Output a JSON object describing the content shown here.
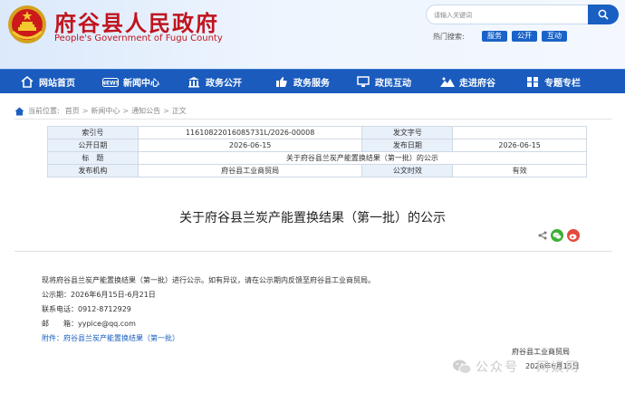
{
  "header": {
    "title_cn": "府谷县人民政府",
    "title_en": "People's Government of Fugu County",
    "search_placeholder": "请输入关键词",
    "hot_label": "热门搜索:",
    "hot_tags": [
      "服务",
      "公开",
      "互动"
    ]
  },
  "nav": {
    "items": [
      {
        "label": "网站首页",
        "icon": "home-icon"
      },
      {
        "label": "新闻中心",
        "icon": "news-icon"
      },
      {
        "label": "政务公开",
        "icon": "building-icon"
      },
      {
        "label": "政务服务",
        "icon": "thumbs-up-icon"
      },
      {
        "label": "政民互动",
        "icon": "monitor-icon"
      },
      {
        "label": "走进府谷",
        "icon": "landscape-icon"
      },
      {
        "label": "专题专栏",
        "icon": "column-icon"
      }
    ]
  },
  "breadcrumb": {
    "label": "当前位置:",
    "items": [
      "首页",
      "新闻中心",
      "通知公告",
      "正文"
    ]
  },
  "meta": {
    "index_label": "索引号",
    "index_value": "11610822016085731L/2026-00008",
    "doc_no_label": "发文字号",
    "doc_no_value": "",
    "open_date_label": "公开日期",
    "open_date_value": "2026-06-15",
    "pub_date_label": "发布日期",
    "pub_date_value": "2026-06-15",
    "title_label": "标　题",
    "title_value": "关于府谷县兰炭产能置换结果（第一批）的公示",
    "issuer_label": "发布机构",
    "issuer_value": "府谷县工业商贸局",
    "validity_label": "公文时效",
    "validity_value": "有效"
  },
  "document": {
    "title": "关于府谷县兰炭产能置换结果（第一批）的公示",
    "lines": [
      "现将府谷县兰炭产能置换结果（第一批）进行公示。如有异议，请在公示期内反馈至府谷县工业商贸局。",
      "公示期：2026年6月15日-6月21日",
      "联系电话：0912-8712929",
      "邮　　箱：yypice@qq.com"
    ],
    "attachment_label": "附件：",
    "attachment": "府谷县兰炭产能置换结果（第一批）",
    "sign_org": "府谷县工业商贸局",
    "sign_date": "2026年6月15日"
  },
  "watermark": {
    "text": "公众号 · 网娱网"
  },
  "colors": {
    "brand_red": "#c0141e",
    "nav_blue": "#1a5bbd",
    "link_blue": "#1a5fc2",
    "table_label_bg": "#e8f0fa"
  }
}
